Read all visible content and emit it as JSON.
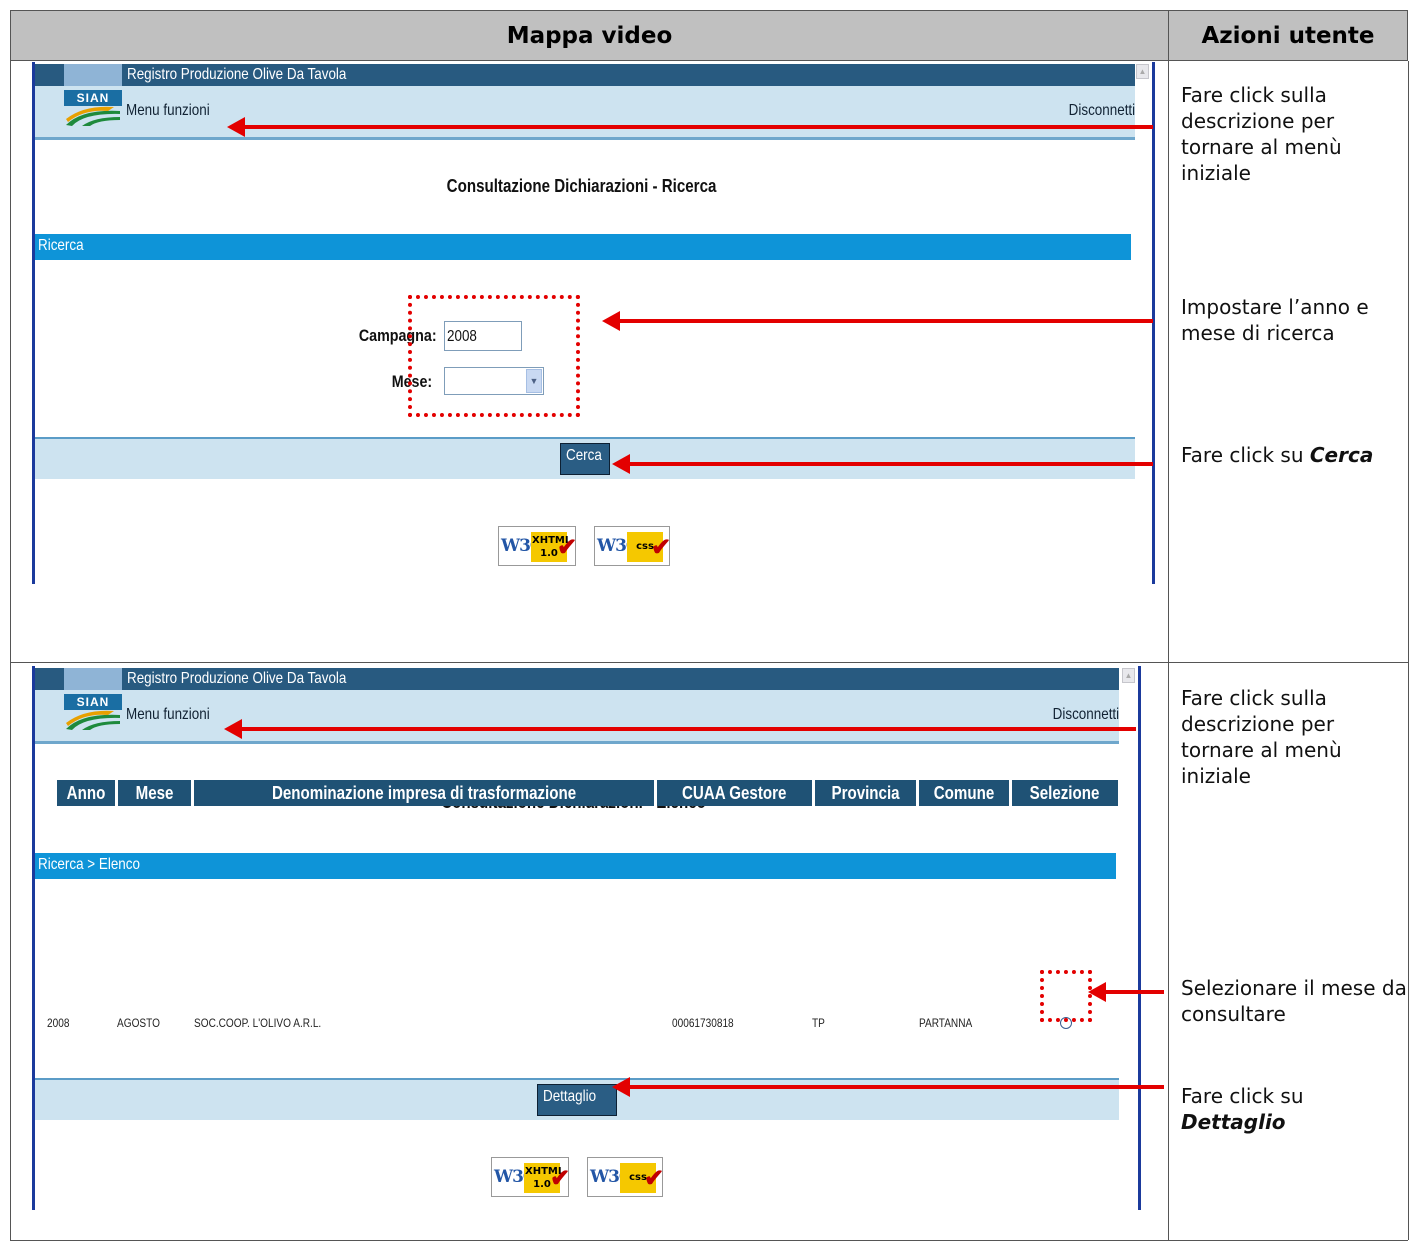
{
  "header": {
    "left": "Mappa video",
    "right": "Azioni utente"
  },
  "app": {
    "title": "Registro Produzione Olive Da Tavola",
    "logo": "SIAN",
    "menu": "Menu funzioni",
    "logout": "Disconnetti"
  },
  "shot1": {
    "page_title": "Consultazione Dichiarazioni - Ricerca",
    "breadcrumb": "Ricerca",
    "campagna_label": "Campagna:",
    "campagna_value": "2008",
    "mese_label": "Mese:",
    "mese_value": "",
    "button": "Cerca"
  },
  "shot2": {
    "page_title": "Consultazione Dichiarazioni - Elenco",
    "breadcrumb": "Ricerca > Elenco",
    "columns": [
      "Anno",
      "Mese",
      "Denominazione impresa di trasformazione",
      "CUAA Gestore",
      "Provincia",
      "Comune",
      "Selezione"
    ],
    "rows": [
      {
        "anno": "2008",
        "mese": "AGOSTO",
        "denominazione": "SOC.COOP. L'OLIVO A.R.L.",
        "cuaa": "00061730818",
        "provincia": "TP",
        "comune": "PARTANNA",
        "selezione": false
      }
    ],
    "button": "Dettaglio"
  },
  "badges": {
    "w3c": "W3C",
    "xhtml": "XHTML",
    "xhtml_version": "1.0",
    "css": "css"
  },
  "actions": {
    "a1": "Fare click sulla descrizione per tornare al menù iniziale",
    "a2": "Impostare l’anno e mese di ricerca",
    "a3_prefix": "Fare click su ",
    "a3_em": "Cerca",
    "a4": "Fare click sulla descrizione per tornare al menù iniziale",
    "a5": "Selezionare il mese da consultare",
    "a6_prefix": "Fare click su ",
    "a6_em": "Dettaglio"
  },
  "colors": {
    "annotation": "#e30000",
    "app_header": "#285a80",
    "breadcrumb_bar": "#0e94d8",
    "menu_bar": "#cde3f0"
  }
}
